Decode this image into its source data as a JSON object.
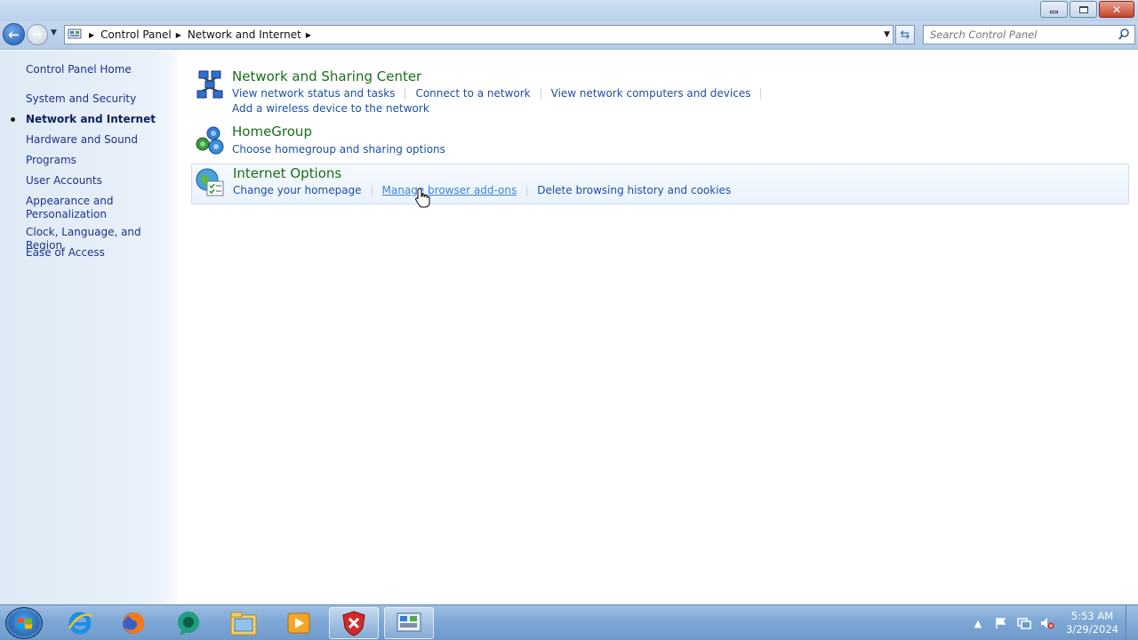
{
  "window": {
    "minimize_label": "",
    "maximize_label": "",
    "close_label": "✕"
  },
  "nav": {
    "breadcrumbs": [
      "Control Panel",
      "Network and Internet"
    ],
    "search_placeholder": "Search Control Panel"
  },
  "sidebar": {
    "items": [
      {
        "label": "Control Panel Home"
      },
      {
        "label": "System and Security"
      },
      {
        "label": "Network and Internet",
        "current": true
      },
      {
        "label": "Hardware and Sound"
      },
      {
        "label": "Programs"
      },
      {
        "label": "User Accounts"
      },
      {
        "label": "Appearance and Personalization"
      },
      {
        "label": "Clock, Language, and Region"
      },
      {
        "label": "Ease of Access"
      }
    ]
  },
  "categories": [
    {
      "title": "Network and Sharing Center",
      "icon": "network-sharing-icon",
      "tasks_row1": [
        "View network status and tasks",
        "Connect to a network",
        "View network computers and devices"
      ],
      "tasks_row2": [
        "Add a wireless device to the network"
      ]
    },
    {
      "title": "HomeGroup",
      "icon": "homegroup-icon",
      "tasks_row1": [
        "Choose homegroup and sharing options"
      ]
    },
    {
      "title": "Internet Options",
      "icon": "internet-options-icon",
      "tasks_row1": [
        "Change your homepage",
        "Manage browser add-ons",
        "Delete browsing history and cookies"
      ]
    }
  ],
  "taskbar": {
    "apps": [
      "internet-explorer-icon",
      "firefox-icon",
      "chat-app-icon",
      "file-explorer-icon",
      "media-player-icon",
      "security-shield-icon",
      "control-panel-icon"
    ],
    "clock_time": "5:53 AM",
    "clock_date": "3/29/2024"
  },
  "colors": {
    "link": "#1c4fa8",
    "category_title": "#1a6e1a",
    "sidebar_link": "#1e3287"
  }
}
